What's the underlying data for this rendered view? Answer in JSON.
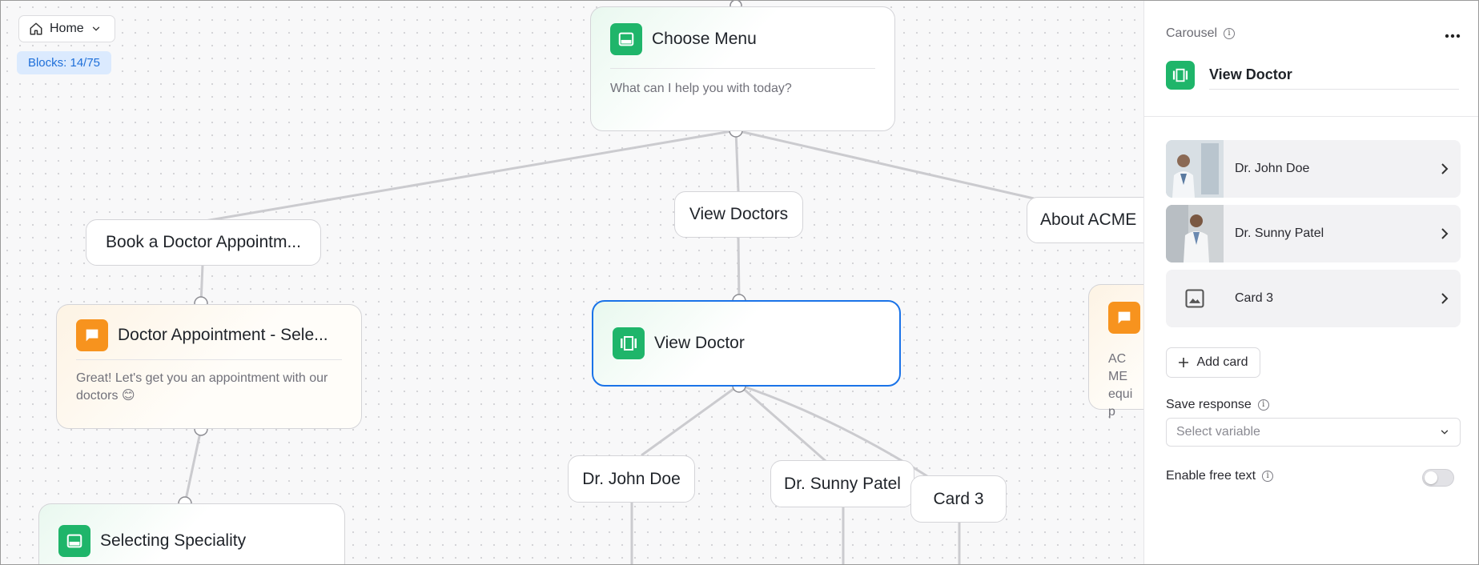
{
  "canvas": {
    "home_label": "Home",
    "blocks_label": "Blocks: 14/75",
    "nodes": {
      "choose_menu": {
        "title": "Choose Menu",
        "body": "What can I help you with today?"
      },
      "doctor_appointment": {
        "title": "Doctor Appointment - Sele...",
        "body": "Great! Let's get you an appointment with our doctors 😊"
      },
      "view_doctor": {
        "title": "View Doctor"
      },
      "selecting_speciality": {
        "title": "Selecting Speciality"
      },
      "about_node": {
        "body": "ACME equip"
      }
    },
    "options": {
      "book": "Book a Doctor Appointm...",
      "view_doctors": "View Doctors",
      "about": "About ACME",
      "john": "Dr. John Doe",
      "sunny": "Dr. Sunny Patel",
      "card3": "Card 3"
    }
  },
  "panel": {
    "type_label": "Carousel",
    "block_name": "View Doctor",
    "cards": [
      {
        "label": "Dr. John Doe",
        "thumb": "photo"
      },
      {
        "label": "Dr. Sunny Patel",
        "thumb": "photo"
      },
      {
        "label": "Card 3",
        "thumb": "image-placeholder-icon"
      }
    ],
    "add_card_label": "Add card",
    "save_response_label": "Save response",
    "select_placeholder": "Select variable",
    "free_text_label": "Enable free text",
    "free_text_enabled": false
  },
  "colors": {
    "accent_blue": "#1a73e8",
    "node_green": "#1fb56a",
    "node_orange": "#f7931e",
    "badge_bg": "#dbeafe",
    "badge_text": "#1e6fd9"
  }
}
